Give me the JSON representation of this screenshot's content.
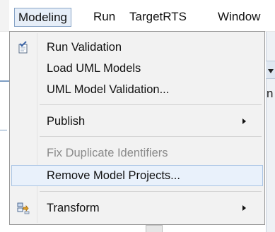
{
  "menubar": {
    "items": [
      {
        "label": "Modeling",
        "active": true
      },
      {
        "label": "Run",
        "active": false
      },
      {
        "label": "TargetRTS",
        "active": false
      },
      {
        "label": "Window",
        "active": false
      }
    ]
  },
  "dropdown": {
    "items": [
      {
        "label": "Run Validation",
        "icon": "validation-check-icon",
        "enabled": true,
        "submenu": false
      },
      {
        "label": "Load UML Models",
        "icon": null,
        "enabled": true,
        "submenu": false
      },
      {
        "label": "UML Model Validation...",
        "icon": null,
        "enabled": true,
        "submenu": false
      },
      {
        "label": "Publish",
        "icon": null,
        "enabled": true,
        "submenu": true
      },
      {
        "label": "Fix Duplicate Identifiers",
        "icon": null,
        "enabled": false,
        "submenu": false
      },
      {
        "label": "Remove Model Projects...",
        "icon": null,
        "enabled": true,
        "submenu": false,
        "highlighted": true
      },
      {
        "label": "Transform",
        "icon": "transform-icon",
        "enabled": true,
        "submenu": true
      }
    ]
  },
  "background": {
    "right_glyph": "n"
  },
  "colors": {
    "menu_background": "#f2f2f2",
    "highlight_background": "#e9f1fb",
    "highlight_border": "#a9c4e4",
    "disabled_text": "#8a8a8a",
    "active_menubar_border": "#88a4c6"
  }
}
